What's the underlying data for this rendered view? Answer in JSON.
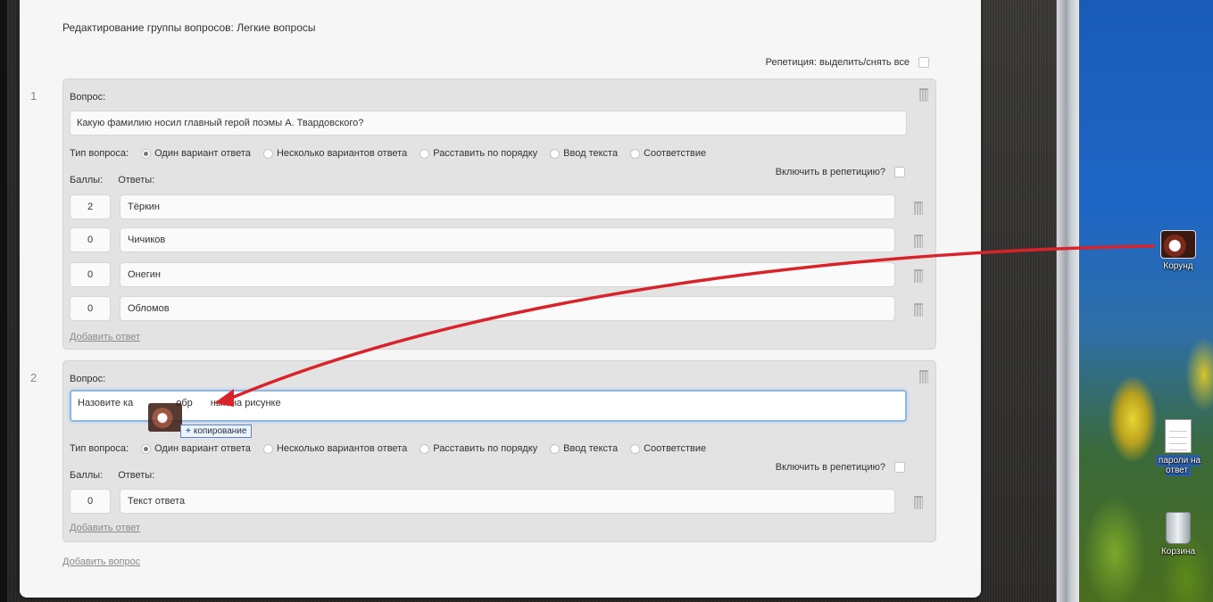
{
  "editor": {
    "page_title": "Редактирование группы вопросов: Легкие вопросы",
    "repetition_toggle_all": "Репетиция: выделить/снять все",
    "add_question_link": "Добавить вопрос"
  },
  "questions": [
    {
      "number": "1",
      "label": "Вопрос:",
      "text": "Какую фамилию носил главный герой поэмы А. Твардовского?",
      "type_label": "Тип вопроса:",
      "types": [
        "Один вариант ответа",
        "Несколько вариантов ответа",
        "Расставить по порядку",
        "Ввод текста",
        "Соответствие"
      ],
      "selected_type": "Один вариант ответа",
      "include_repetition": "Включить в репетицию?",
      "points_header": "Баллы:",
      "answers_header": "Ответы:",
      "answers": [
        {
          "points": "2",
          "text": "Тёркин"
        },
        {
          "points": "0",
          "text": "Чичиков"
        },
        {
          "points": "0",
          "text": "Онегин"
        },
        {
          "points": "0",
          "text": "Обломов"
        }
      ],
      "add_answer_link": "Добавить ответ"
    },
    {
      "number": "2",
      "label": "Вопрос:",
      "text_before": "Назовите ка",
      "text_after": "обр",
      "text_tail": "ный на рисунке",
      "type_label": "Тип вопроса:",
      "types": [
        "Один вариант ответа",
        "Несколько вариантов ответа",
        "Расставить по порядку",
        "Ввод текста",
        "Соответствие"
      ],
      "selected_type": "Один вариант ответа",
      "include_repetition": "Включить в репетицию?",
      "points_header": "Баллы:",
      "answers_header": "Ответы:",
      "answers": [
        {
          "points": "0",
          "text": "Текст ответа"
        }
      ],
      "add_answer_link": "Добавить ответ"
    }
  ],
  "drag": {
    "tooltip": "копирование"
  },
  "desktop": {
    "icons": [
      {
        "label": "Корунд",
        "icon": "photo-icon"
      },
      {
        "label": "пароли на ответ",
        "icon": "text-document-icon"
      },
      {
        "label": "Корзина",
        "icon": "recycle-bin-icon"
      }
    ]
  },
  "colors": {
    "panel_bg": "#f6f6f6",
    "question_block_bg": "#e3e3e3",
    "focus_border": "#8cb8e6",
    "arrow": "#d8232a",
    "desktop_blue": "#1f66c4"
  }
}
